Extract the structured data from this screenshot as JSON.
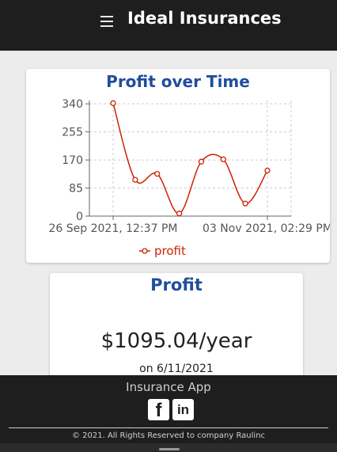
{
  "header": {
    "menu_icon": "hamburger-menu-icon",
    "title": "Ideal Insurances"
  },
  "chart_data": {
    "type": "line",
    "title": "Profit over Time",
    "x_tick_labels": [
      "26 Sep 2021, 12:37 PM",
      "03 Nov 2021, 02:29 PM"
    ],
    "y_ticks": [
      0,
      85,
      170,
      255,
      340
    ],
    "ylim": [
      0,
      350
    ],
    "series": [
      {
        "name": "profit",
        "color": "#cc2200",
        "values": [
          342,
          110,
          128,
          8,
          165,
          172,
          38,
          138
        ]
      }
    ],
    "legend_position": "bottom-center",
    "grid": true,
    "curve": "smooth"
  },
  "profit_card": {
    "title": "Profit",
    "amount": "$1095.04/year",
    "date": "on 6/11/2021"
  },
  "footer": {
    "title": "Insurance App",
    "facebook_icon": "facebook-icon",
    "linkedin_icon": "linkedin-icon",
    "copyright": "© 2021. All Rights Reserved to company Raulinc"
  }
}
